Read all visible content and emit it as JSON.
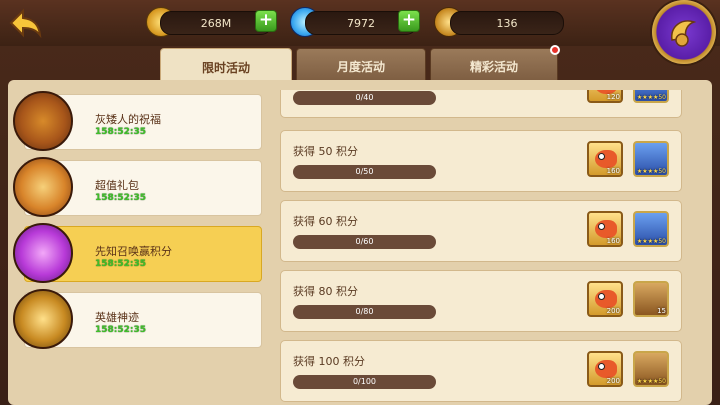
{
  "top": {
    "gold": "268M",
    "gems": "7972",
    "tokens": "136"
  },
  "tabs": [
    {
      "label": "限时活动",
      "active": true
    },
    {
      "label": "月度活动",
      "active": false
    },
    {
      "label": "精彩活动",
      "active": false,
      "notification": true
    }
  ],
  "events": [
    {
      "title": "灰矮人的祝福",
      "timer": "158:52:35",
      "icon": "lantern-icon",
      "selected": false
    },
    {
      "title": "超值礼包",
      "timer": "158:52:35",
      "icon": "gift-box-icon",
      "selected": false
    },
    {
      "title": "先知召唤赢积分",
      "timer": "158:52:35",
      "icon": "summon-scroll-icon",
      "selected": true
    },
    {
      "title": "英雄神迹",
      "timer": "158:52:35",
      "icon": "hero-shrine-icon",
      "selected": false
    }
  ],
  "rewards": [
    {
      "label": "",
      "progress": "0/40",
      "items": [
        {
          "icon": "fish-icon",
          "count": "120"
        },
        {
          "icon": "hero-card-icon",
          "stars": "★★★★50"
        }
      ]
    },
    {
      "label": "获得 50 积分",
      "progress": "0/50",
      "items": [
        {
          "icon": "fish-icon",
          "count": "160"
        },
        {
          "icon": "hero-card-icon",
          "stars": "★★★★50"
        }
      ]
    },
    {
      "label": "获得 60 积分",
      "progress": "0/60",
      "items": [
        {
          "icon": "fish-icon",
          "count": "160"
        },
        {
          "icon": "hero-card-icon",
          "stars": "★★★★50"
        }
      ]
    },
    {
      "label": "获得 80 积分",
      "progress": "0/80",
      "items": [
        {
          "icon": "fish-icon",
          "count": "200"
        },
        {
          "icon": "horn-icon",
          "count": "15"
        }
      ]
    },
    {
      "label": "获得 100 积分",
      "progress": "0/100",
      "items": [
        {
          "icon": "fish-icon",
          "count": "200"
        },
        {
          "icon": "hero-card-icon",
          "stars": "★★★★50"
        }
      ]
    }
  ],
  "colors": {
    "selected": "#f6cf53",
    "timer": "#3fbf2a",
    "accent": "#e8322a"
  }
}
